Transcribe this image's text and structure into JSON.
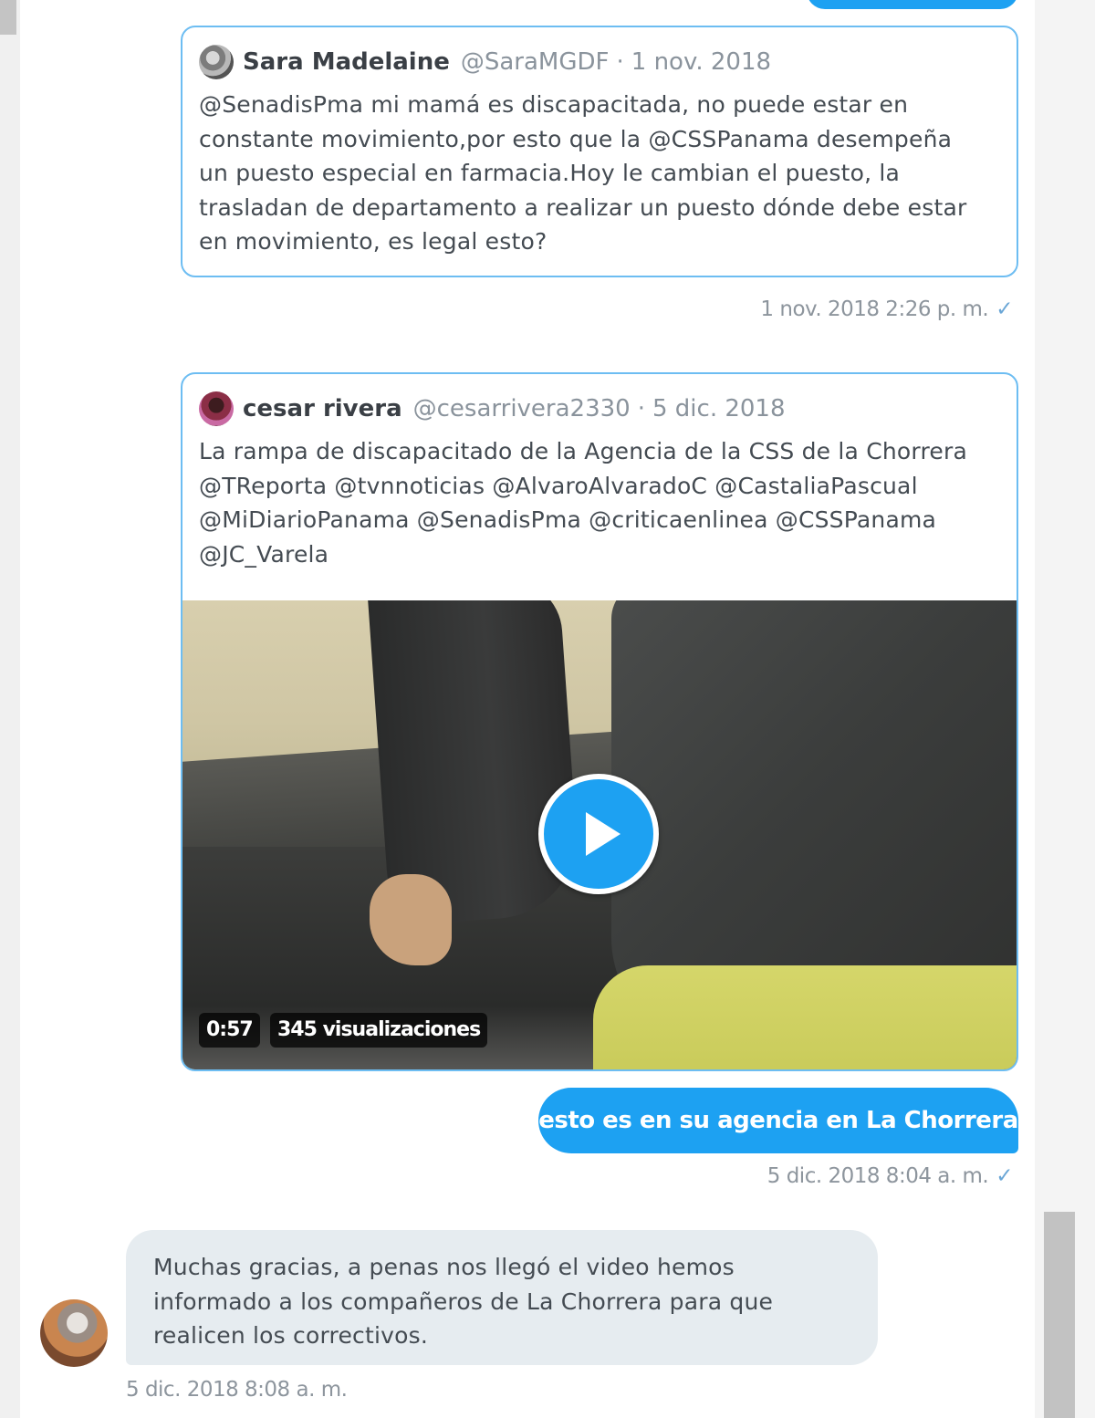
{
  "conversation": {
    "card1": {
      "author_name": "Sara Madelaine",
      "author_handle": "@SaraMGDF",
      "separator": "·",
      "date": "1 nov. 2018",
      "text": "@SenadisPma mi mamá es discapacitada, no puede estar en\nconstante movimiento,por esto que la @CSSPanama  desempeña\nun puesto especial en farmacia.Hoy le cambian el puesto, la\ntrasladan de departamento a realizar un puesto dónde debe estar\nen movimiento, es legal esto?",
      "avatar_icon": "profile-photo-avatar"
    },
    "timestamp1": "1 nov. 2018 2:26 p. m.",
    "card2": {
      "author_name": "cesar rivera",
      "author_handle": "@cesarrivera2330",
      "separator": "·",
      "date": "5 dic. 2018",
      "text": "La rampa de discapacitado de la Agencia de la CSS de la Chorrera\n@TReporta @tvnnoticias  @AlvaroAlvaradoC @CastaliaPascual\n@MiDiarioPanama @SenadisPma @criticaenlinea @CSSPanama\n@JC_Varela",
      "avatar_icon": "profile-photo-avatar",
      "video": {
        "duration": "0:57",
        "views": "345 visualizaciones",
        "play_icon": "play-icon"
      }
    },
    "sent_message": "esto es en su agencia en La Chorrera",
    "timestamp2": "5 dic. 2018 8:04 a. m.",
    "received_message": "Muchas gracias, a penas nos llegó el video hemos\ninformado a los compañeros de La Chorrera para que\nrealicen los correctivos.",
    "timestamp3": "5 dic. 2018 8:08 a. m.",
    "read_check": "✓"
  },
  "colors": {
    "accent": "#1da1f2",
    "card_border": "#6dbdf2",
    "received_bubble": "#e6ecf0",
    "muted_text": "#8d959d"
  }
}
